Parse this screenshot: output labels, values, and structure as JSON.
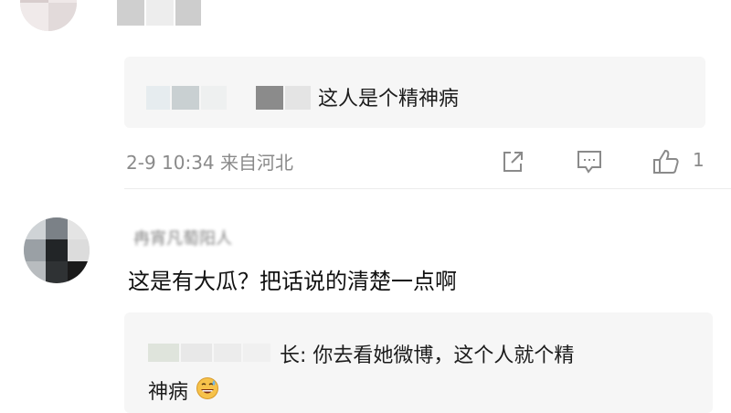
{
  "top_comment": {
    "reply": {
      "text": "这人是个精神病"
    },
    "meta": {
      "time_location": "2-9 10:34 来自河北",
      "like_count": "1"
    },
    "icons": [
      "share-icon",
      "comment-icon",
      "like-icon"
    ]
  },
  "comment_2": {
    "username": "冉宵凡萄阳人",
    "text": "这是有大瓜？把话说的清楚一点啊",
    "reply": {
      "line1": "长: 你去看她微博，这个人就个精",
      "line2": "神病",
      "emoji": "grin-sweat-emoji"
    }
  },
  "colors": {
    "text_primary": "#1c1c1c",
    "text_meta": "#8a8a8a",
    "card_bg": "#f6f6f6"
  }
}
